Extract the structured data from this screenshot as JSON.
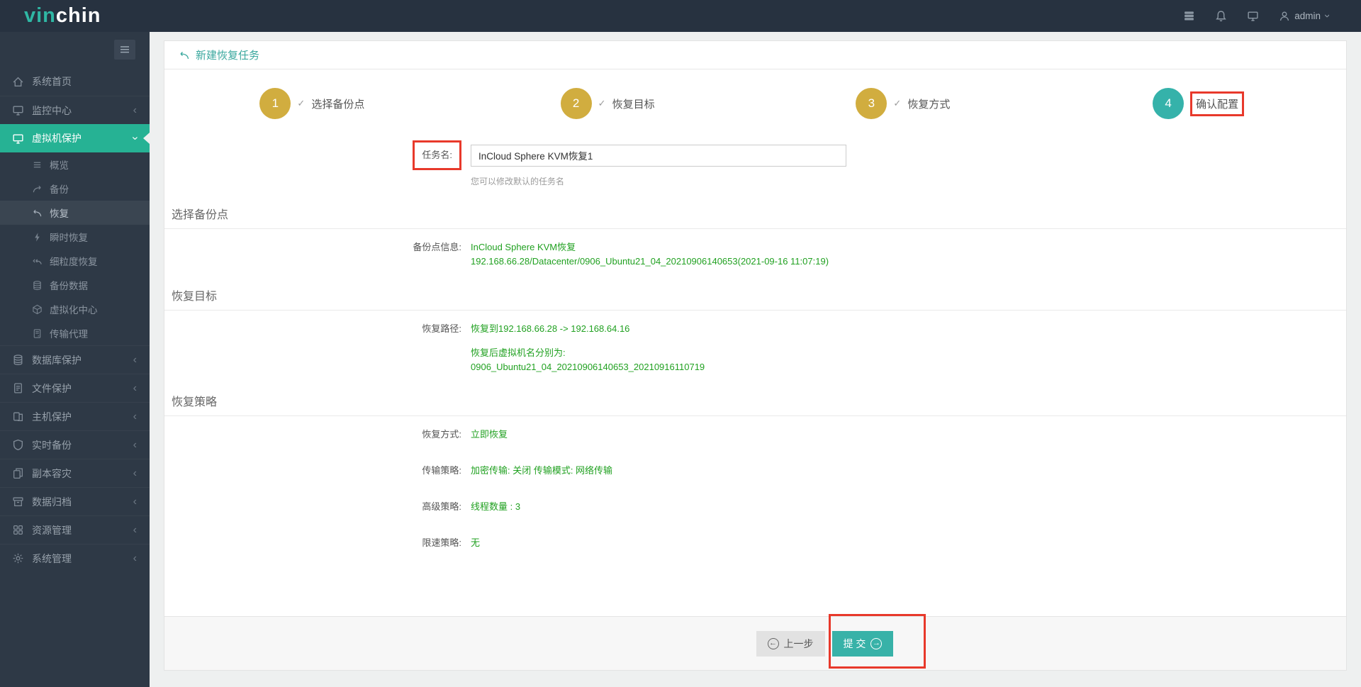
{
  "brand": {
    "name_teal": "vin",
    "name_white": "chin"
  },
  "topbar": {
    "username": "admin"
  },
  "sidebar": {
    "items": [
      {
        "label": "系统首页",
        "icon": "home-icon"
      },
      {
        "label": "监控中心",
        "icon": "monitor-icon"
      },
      {
        "label": "虚拟机保护",
        "icon": "display-icon",
        "active": true,
        "children": [
          {
            "label": "概览",
            "icon": "list-icon"
          },
          {
            "label": "备份",
            "icon": "redo-arrow-icon"
          },
          {
            "label": "恢复",
            "icon": "reply-arrow-icon",
            "selected": true
          },
          {
            "label": "瞬时恢复",
            "icon": "bolt-icon"
          },
          {
            "label": "细粒度恢复",
            "icon": "double-reply-arrow-icon"
          },
          {
            "label": "备份数据",
            "icon": "database-stack-icon"
          },
          {
            "label": "虚拟化中心",
            "icon": "cube-icon"
          },
          {
            "label": "传输代理",
            "icon": "server-icon"
          }
        ]
      },
      {
        "label": "数据库保护",
        "icon": "database-icon"
      },
      {
        "label": "文件保护",
        "icon": "file-icon"
      },
      {
        "label": "主机保护",
        "icon": "host-icon"
      },
      {
        "label": "实时备份",
        "icon": "shield-icon"
      },
      {
        "label": "副本容灾",
        "icon": "copy-icon"
      },
      {
        "label": "数据归档",
        "icon": "archive-icon"
      },
      {
        "label": "资源管理",
        "icon": "grid-icon"
      },
      {
        "label": "系统管理",
        "icon": "gear-icon"
      }
    ]
  },
  "page": {
    "title": "新建恢复任务"
  },
  "steps": [
    {
      "num": "1",
      "label": "选择备份点",
      "done": true
    },
    {
      "num": "2",
      "label": "恢复目标",
      "done": true
    },
    {
      "num": "3",
      "label": "恢复方式",
      "done": true
    },
    {
      "num": "4",
      "label": "确认配置",
      "done": false,
      "current": true,
      "annotated": true
    }
  ],
  "form": {
    "task_name_label": "任务名:",
    "task_name_value": "InCloud Sphere KVM恢复1",
    "task_name_hint": "您可以修改默认的任务名"
  },
  "sections": {
    "backup_point": {
      "title": "选择备份点",
      "row_label": "备份点信息:",
      "line1": "InCloud Sphere KVM恢复",
      "line2": "192.168.66.28/Datacenter/0906_Ubuntu21_04_20210906140653(2021-09-16 11:07:19)"
    },
    "restore_target": {
      "title": "恢复目标",
      "row_label": "恢复路径:",
      "path_value": "恢复到192.168.66.28 -> 192.168.64.16",
      "vm_name_caption": "恢复后虚拟机名分别为:",
      "vm_name_value": "0906_Ubuntu21_04_20210906140653_20210916110719"
    },
    "restore_strategy": {
      "title": "恢复策略",
      "rows": [
        {
          "label": "恢复方式:",
          "value": "立即恢复"
        },
        {
          "label": "传输策略:",
          "value": "加密传输: 关闭 传输模式: 网络传输"
        },
        {
          "label": "高级策略:",
          "value": "线程数量 : 3"
        },
        {
          "label": "限速策略:",
          "value": "无"
        }
      ]
    }
  },
  "footer": {
    "prev_label": "上一步",
    "submit_label": "提 交"
  },
  "colors": {
    "accent_teal": "#26b294",
    "title_teal": "#3aa89e",
    "step_gold": "#d1ad3f",
    "step_current_teal": "#35b2aa",
    "value_green": "#21a121",
    "annotation_red": "#e8392b"
  }
}
